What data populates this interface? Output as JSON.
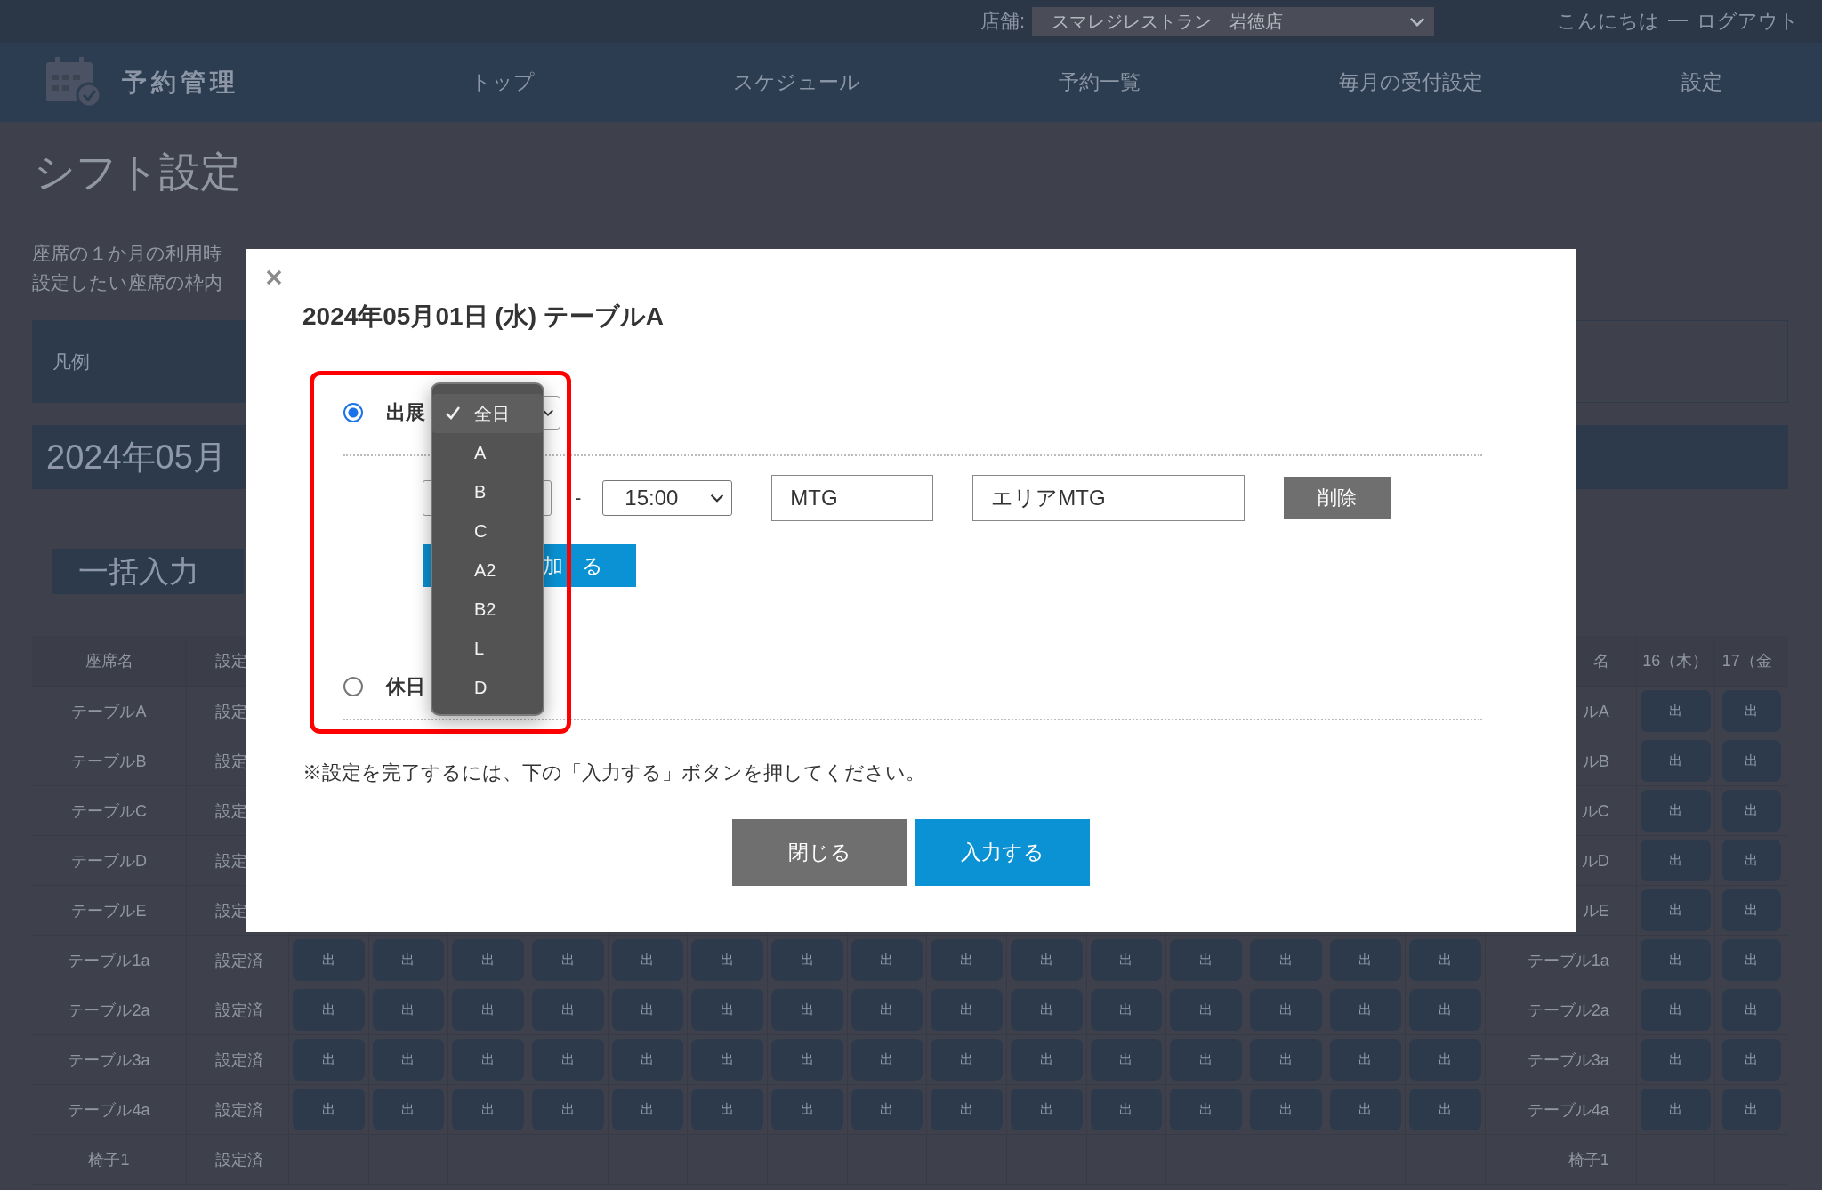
{
  "top_bar": {
    "store_label": "店舗:",
    "store_select": "スマレジレストラン　岩徳店",
    "greeting": "こんにちは",
    "separator": "—",
    "logout": "ログアウト"
  },
  "nav": {
    "app_name": "予約管理",
    "items": [
      {
        "label": "トップ"
      },
      {
        "label": "スケジュール"
      },
      {
        "label": "予約一覧"
      },
      {
        "label": "毎月の受付設定"
      },
      {
        "label": "設定"
      }
    ]
  },
  "page": {
    "title": "シフト設定",
    "description": [
      "座席の１か月の利用時",
      "設定したい座席の枠内"
    ],
    "legend_title": "凡例",
    "month": "2024年05月",
    "bulk_button": "一括入力",
    "table": {
      "columns": {
        "seat": "座席名",
        "status": "設定",
        "seat_right": "名",
        "day_16": "16（木）",
        "day_17": "17（金"
      },
      "rows": [
        {
          "seat": "テーブルA",
          "status": "設定",
          "seat_right": "ルA",
          "right_cells": [
            "出",
            "出"
          ]
        },
        {
          "seat": "テーブルB",
          "status": "設定",
          "seat_right": "ルB",
          "right_cells": [
            "出",
            "出"
          ]
        },
        {
          "seat": "テーブルC",
          "status": "設定",
          "seat_right": "ルC",
          "right_cells": [
            "出",
            "出"
          ]
        },
        {
          "seat": "テーブルD",
          "status": "設定",
          "seat_right": "ルD",
          "right_cells": [
            "出",
            "出"
          ]
        },
        {
          "seat": "テーブルE",
          "status": "設定",
          "seat_right": "ルE",
          "right_cells": [
            "出",
            "出"
          ]
        },
        {
          "seat": "テーブル1a",
          "status": "設定済",
          "day_cells": [
            "出",
            "出",
            "出",
            "出",
            "出",
            "出",
            "出",
            "出",
            "出",
            "出",
            "出",
            "出",
            "出",
            "出",
            "出"
          ],
          "seat_right": "テーブル1a",
          "right_cells": [
            "出",
            "出"
          ]
        },
        {
          "seat": "テーブル2a",
          "status": "設定済",
          "day_cells": [
            "出",
            "出",
            "出",
            "出",
            "出",
            "出",
            "出",
            "出",
            "出",
            "出",
            "出",
            "出",
            "出",
            "出",
            "出"
          ],
          "seat_right": "テーブル2a",
          "right_cells": [
            "出",
            "出"
          ]
        },
        {
          "seat": "テーブル3a",
          "status": "設定済",
          "day_cells": [
            "出",
            "出",
            "出",
            "出",
            "出",
            "出",
            "出",
            "出",
            "出",
            "出",
            "出",
            "出",
            "出",
            "出",
            "出"
          ],
          "seat_right": "テーブル3a",
          "right_cells": [
            "出",
            "出"
          ]
        },
        {
          "seat": "テーブル4a",
          "status": "設定済",
          "day_cells": [
            "出",
            "出",
            "出",
            "出",
            "出",
            "出",
            "出",
            "出",
            "出",
            "出",
            "出",
            "出",
            "出",
            "出",
            "出"
          ],
          "seat_right": "テーブル4a",
          "right_cells": [
            "出",
            "出"
          ]
        },
        {
          "seat": "椅子1",
          "status": "設定済",
          "seat_right": "椅子1"
        }
      ]
    }
  },
  "dialog": {
    "title": "2024年05月01日 (水) テーブルA",
    "options": [
      {
        "label": "出展",
        "selected": true
      },
      {
        "label": "休日",
        "selected": false
      }
    ],
    "time_row": {
      "separator": "-",
      "end_time": "15:00",
      "name_value": "MTG",
      "area_value": "エリアMTG",
      "delete_button": "削除"
    },
    "add_button": "加 る",
    "note": "※設定を完了するには、下の「入力する」ボタンを押してください。",
    "buttons": [
      {
        "label": "閉じる",
        "kind": "secondary"
      },
      {
        "label": "入力する",
        "kind": "primary"
      }
    ],
    "dropdown": {
      "items": [
        {
          "label": "全日",
          "selected": true
        },
        {
          "label": "A",
          "selected": false
        },
        {
          "label": "B",
          "selected": false
        },
        {
          "label": "C",
          "selected": false
        },
        {
          "label": "A2",
          "selected": false
        },
        {
          "label": "B2",
          "selected": false
        },
        {
          "label": "L",
          "selected": false
        },
        {
          "label": "D",
          "selected": false
        }
      ]
    },
    "annotation": {
      "kind": "highlight-frame"
    }
  }
}
